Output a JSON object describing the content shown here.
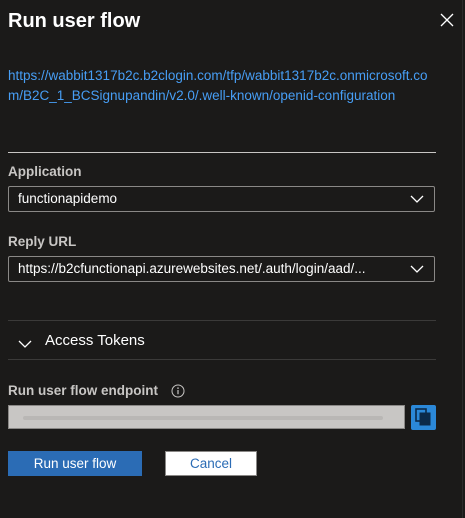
{
  "panel": {
    "title": "Run user flow",
    "close_icon": "close-icon"
  },
  "metadata_url": "https://wabbit1317b2c.b2clogin.com/tfp/wabbit1317b2c.onmicrosoft.com/B2C_1_BCSignupandin/v2.0/.well-known/openid-configuration",
  "application": {
    "label": "Application",
    "value": "functionapidemo",
    "icon": "chevron-down-icon"
  },
  "reply_url": {
    "label": "Reply URL",
    "value": "https://b2cfunctionapi.azurewebsites.net/.auth/login/aad/...",
    "icon": "chevron-down-icon"
  },
  "access_tokens": {
    "label": "Access Tokens",
    "icon": "chevron-down-icon"
  },
  "endpoint": {
    "label": "Run user flow endpoint",
    "info_icon": "info-icon",
    "copy_icon": "copy-icon"
  },
  "actions": {
    "run_label": "Run user flow",
    "cancel_label": "Cancel"
  },
  "colors": {
    "background": "#1b1a19",
    "link": "#479ef5",
    "primary": "#2b6cb5",
    "copy_button": "#2b88d8"
  }
}
